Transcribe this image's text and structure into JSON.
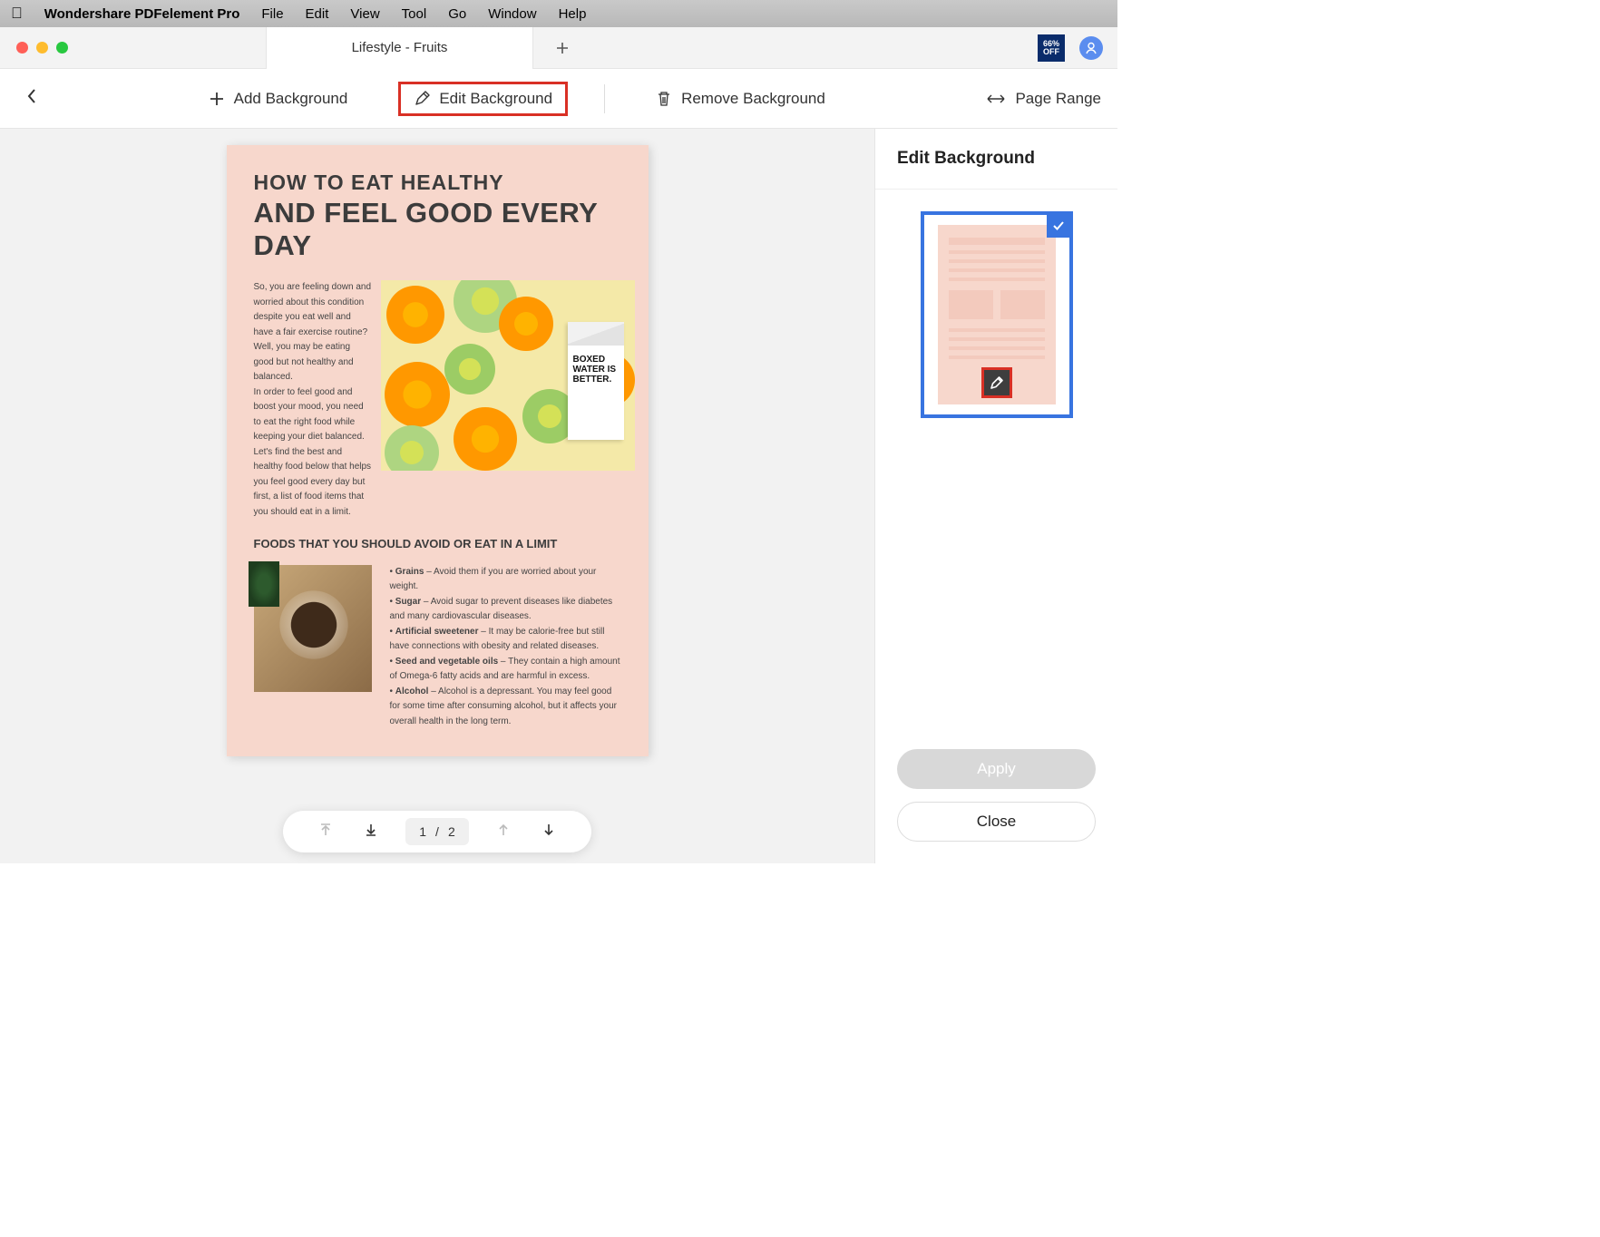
{
  "menubar": {
    "app_name": "Wondershare PDFelement Pro",
    "items": [
      "File",
      "Edit",
      "View",
      "Tool",
      "Go",
      "Window",
      "Help"
    ]
  },
  "tabbar": {
    "tab_title": "Lifestyle - Fruits",
    "promo_line1": "66%",
    "promo_line2": "OFF"
  },
  "toolbar": {
    "add_bg": "Add Background",
    "edit_bg": "Edit Background",
    "remove_bg": "Remove Background",
    "page_range": "Page Range"
  },
  "document": {
    "title_line1": "HOW TO EAT HEALTHY",
    "title_line2": "AND FEEL GOOD EVERY DAY",
    "intro": "So, you are feeling down and worried about this condition despite you eat well and have a fair exercise routine? Well, you may be eating good but not healthy and balanced.\nIn order to feel good and boost your mood, you need to eat the right food while keeping your diet balanced. Let's find the best and healthy food below that helps you feel good every day but first, a list of food items that you should eat in a limit.",
    "carton_text": "BOXED WATER IS BETTER.",
    "subhead": "FOODS THAT YOU SHOULD AVOID OR EAT IN A LIMIT",
    "bullets": [
      {
        "term": "Grains",
        "text": " – Avoid them if you are worried about your weight."
      },
      {
        "term": "Sugar",
        "text": " – Avoid sugar to prevent diseases like diabetes and many cardiovascular diseases."
      },
      {
        "term": "Artificial sweetener",
        "text": " – It may be calorie-free but still have connections with obesity and related diseases."
      },
      {
        "term": "Seed and vegetable oils",
        "text": " – They contain a high amount of Omega-6 fatty acids and are harmful in excess."
      },
      {
        "term": "Alcohol",
        "text": " – Alcohol is a depressant. You may feel good for some time after consuming alcohol, but it affects your overall health in the long term."
      }
    ]
  },
  "pagenav": {
    "current": "1",
    "sep": "/",
    "total": "2"
  },
  "sidepanel": {
    "title": "Edit Background",
    "apply": "Apply",
    "close": "Close"
  }
}
